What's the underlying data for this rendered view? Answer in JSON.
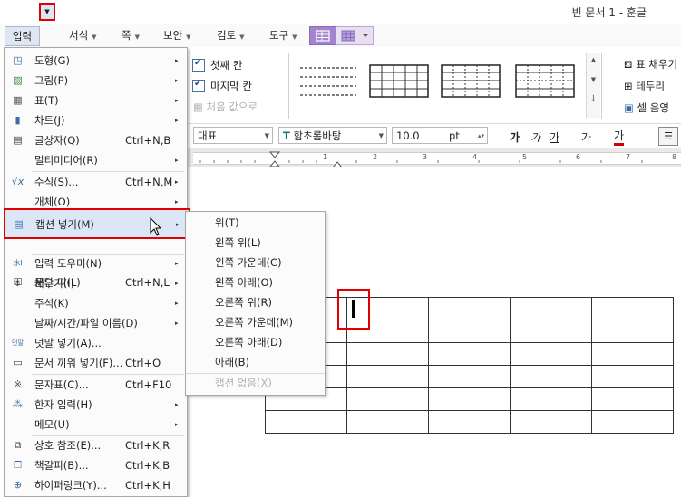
{
  "window": {
    "title": "빈 문서 1 - 훈글"
  },
  "menubar": {
    "tabs": [
      {
        "label": "입력"
      },
      {
        "label": "서식"
      },
      {
        "label": "쪽"
      },
      {
        "label": "보안"
      },
      {
        "label": "검토"
      },
      {
        "label": "도구"
      }
    ]
  },
  "ribbon": {
    "first_col": "첫째 칸",
    "last_col": "마지막 칸",
    "total_value": "처음 값으로",
    "fill": "표 채우기",
    "border": "테두리",
    "cell_shade": "셀 음영"
  },
  "format": {
    "style": "대표",
    "font": "함초롬바탕",
    "font_icon": "T",
    "size": "10.0",
    "unit": "pt",
    "bold": "가",
    "italic": "가",
    "underline": "가",
    "strike": "가",
    "color": "가"
  },
  "ruler": {
    "labels": [
      "1",
      "1",
      "2",
      "3",
      "4",
      "5",
      "6",
      "7",
      "8"
    ]
  },
  "menu": {
    "items": [
      {
        "label": "도형(G)",
        "shortcut": "",
        "sub": "▸",
        "icon": "shape-icon"
      },
      {
        "label": "그림(P)",
        "shortcut": "",
        "sub": "▸",
        "icon": "picture-icon"
      },
      {
        "label": "표(T)",
        "shortcut": "",
        "sub": "▸",
        "icon": "table-icon"
      },
      {
        "label": "차트(J)",
        "shortcut": "",
        "sub": "▸",
        "icon": "chart-icon"
      },
      {
        "label": "글상자(Q)",
        "shortcut": "Ctrl+N,B",
        "sub": "",
        "icon": "textbox-icon"
      },
      {
        "label": "멀티미디어(R)",
        "shortcut": "",
        "sub": "▸",
        "icon": ""
      },
      {
        "label": "수식(S)...",
        "shortcut": "Ctrl+N,M",
        "sub": "▸",
        "icon": "formula-icon"
      },
      {
        "label": "개체(O)",
        "shortcut": "",
        "sub": "▸",
        "icon": ""
      },
      {
        "label": "캡션 넣기(M)",
        "shortcut": "",
        "sub": "▸",
        "icon": "caption-icon"
      },
      {
        "label": "문단 띠(L)",
        "shortcut": "Ctrl+N,L",
        "sub": "",
        "icon": "paragraph-band-icon"
      },
      {
        "label": "입력 도우미(N)",
        "shortcut": "",
        "sub": "▸",
        "icon": "input-helper-icon"
      },
      {
        "label": "채우기(I)",
        "shortcut": "",
        "sub": "▸",
        "icon": "fill-icon"
      },
      {
        "label": "주석(K)",
        "shortcut": "",
        "sub": "▸",
        "icon": ""
      },
      {
        "label": "날짜/시간/파일 이름(D)",
        "shortcut": "",
        "sub": "▸",
        "icon": ""
      },
      {
        "label": "덧말 넣기(A)...",
        "shortcut": "",
        "sub": "",
        "icon": "ruby-text-icon"
      },
      {
        "label": "문서 끼워 넣기(F)...",
        "shortcut": "Ctrl+O",
        "sub": "",
        "icon": "insert-doc-icon"
      },
      {
        "label": "문자표(C)...",
        "shortcut": "Ctrl+F10",
        "sub": "",
        "icon": "symbol-icon"
      },
      {
        "label": "한자 입력(H)",
        "shortcut": "",
        "sub": "▸",
        "icon": "hanja-icon"
      },
      {
        "label": "메모(U)",
        "shortcut": "",
        "sub": "▸",
        "icon": ""
      },
      {
        "label": "상호 참조(E)...",
        "shortcut": "Ctrl+K,R",
        "sub": "",
        "icon": "cross-ref-icon"
      },
      {
        "label": "책갈피(B)...",
        "shortcut": "Ctrl+K,B",
        "sub": "",
        "icon": "bookmark-icon"
      },
      {
        "label": "하이퍼링크(Y)...",
        "shortcut": "Ctrl+K,H",
        "sub": "",
        "icon": "hyperlink-icon"
      }
    ]
  },
  "submenu": {
    "items": [
      {
        "label": "위(T)"
      },
      {
        "label": "왼쪽 위(L)"
      },
      {
        "label": "왼쪽 가운데(C)"
      },
      {
        "label": "왼쪽 아래(O)"
      },
      {
        "label": "오른쪽 위(R)"
      },
      {
        "label": "오른쪽 가운데(M)"
      },
      {
        "label": "오른쪽 아래(D)"
      },
      {
        "label": "아래(B)"
      },
      {
        "label": "캡션 없음(X)"
      }
    ]
  },
  "colors": {
    "highlight_red": "#e00000",
    "menu_hover": "#dbe7f7",
    "accent_purple": "#a385cf"
  }
}
